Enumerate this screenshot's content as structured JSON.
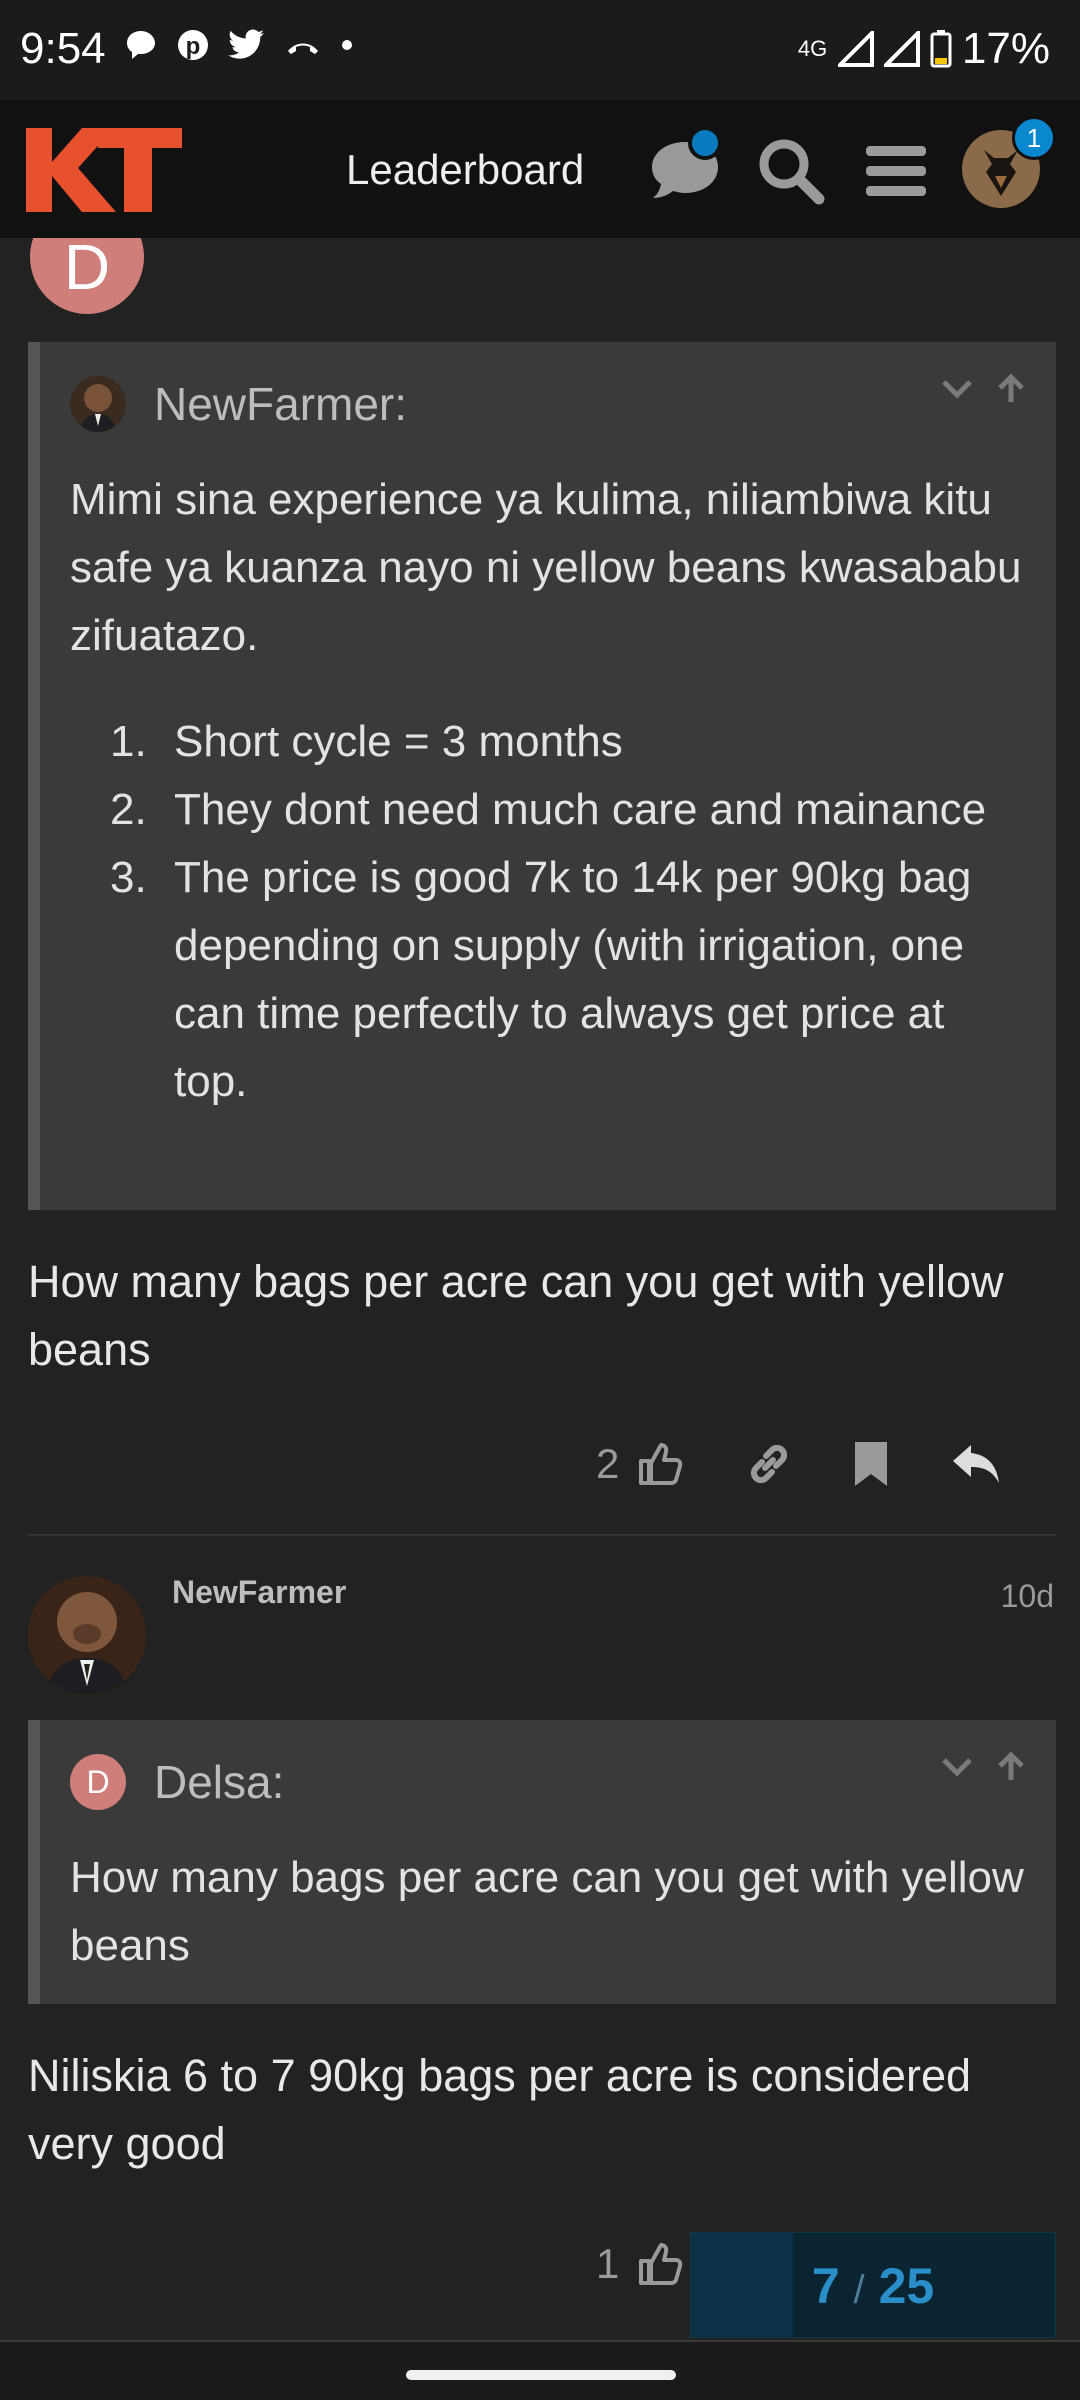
{
  "status_bar": {
    "time": "9:54",
    "network": "4G",
    "battery": "17%"
  },
  "header": {
    "logo_text": "KT",
    "leaderboard_label": "Leaderboard",
    "notification_count": "1"
  },
  "top_avatar_letter": "D",
  "post1": {
    "quote": {
      "author": "NewFarmer:",
      "paragraph": "Mimi sina experience ya kulima, niliambiwa kitu safe ya kuanza nayo ni yellow beans kwasababu zifuatazo.",
      "list": [
        {
          "num": "1.",
          "text": "Short cycle = 3 months"
        },
        {
          "num": "2.",
          "text": "They dont need much care and mainance"
        },
        {
          "num": "3.",
          "text": "The price is good 7k to 14k per 90kg bag depending on supply (with irrigation, one can time perfectly to always get price at top."
        }
      ]
    },
    "body": "How many bags per acre can you get with yellow beans",
    "like_count": "2"
  },
  "post2": {
    "username": "NewFarmer",
    "date": "10d",
    "quote": {
      "avatar_letter": "D",
      "author": "Delsa:",
      "text": "How many bags per acre can you get with yellow beans"
    },
    "body": "Niliskia 6 to 7 90kg bags per acre is considered very good",
    "like_count": "1"
  },
  "progress": {
    "current": "7",
    "separator": "/",
    "total": "25"
  },
  "colors": {
    "background": "#222222",
    "brand": "#e8512e",
    "accent": "#0a88cf",
    "quote_bg": "#3a3a3a"
  }
}
